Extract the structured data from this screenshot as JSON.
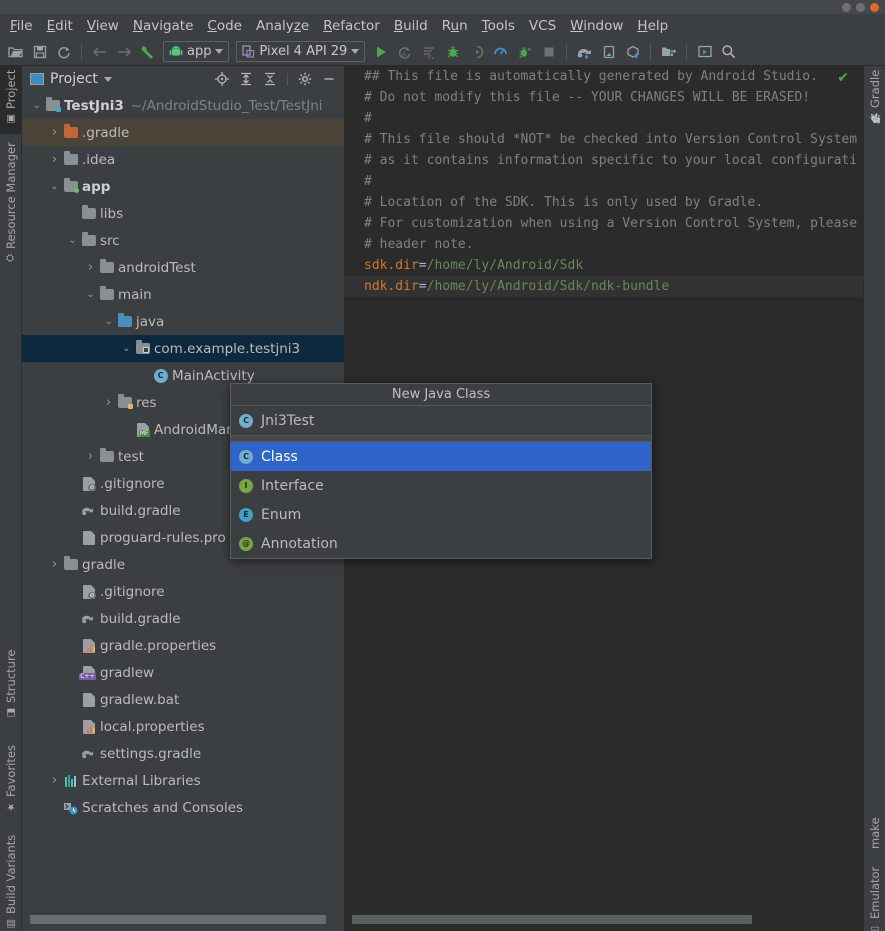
{
  "window": {
    "controls": [
      "minimize",
      "maximize",
      "close"
    ]
  },
  "menubar": {
    "items": [
      {
        "label": "File",
        "mnemonic": "F"
      },
      {
        "label": "Edit",
        "mnemonic": "E"
      },
      {
        "label": "View",
        "mnemonic": "V"
      },
      {
        "label": "Navigate",
        "mnemonic": "N"
      },
      {
        "label": "Code",
        "mnemonic": "C"
      },
      {
        "label": "Analyze",
        "mnemonic": "z"
      },
      {
        "label": "Refactor",
        "mnemonic": "R"
      },
      {
        "label": "Build",
        "mnemonic": "B"
      },
      {
        "label": "Run",
        "mnemonic": "u"
      },
      {
        "label": "Tools",
        "mnemonic": "T"
      },
      {
        "label": "VCS",
        "mnemonic": ""
      },
      {
        "label": "Window",
        "mnemonic": "W"
      },
      {
        "label": "Help",
        "mnemonic": "H"
      }
    ]
  },
  "toolbar": {
    "icons_left": [
      "open-folder-icon",
      "save-icon",
      "sync-icon"
    ],
    "nav_icons": [
      "back-arrow-icon",
      "forward-arrow-icon",
      "hammer-icon"
    ],
    "run_config": {
      "label": "app",
      "icon": "android-robot-icon"
    },
    "device": {
      "label": "Pixel 4 API 29",
      "icon": "device-icon"
    },
    "run_icons": [
      "run-icon",
      "apply-changes-icon",
      "apply-code-changes-icon",
      "debug-icon",
      "attach-debugger-icon",
      "profiler-icon",
      "run-with-coverage-icon",
      "stop-icon"
    ],
    "gradle_icons": [
      "gradle-sync-icon",
      "avd-manager-icon",
      "sdk-manager-icon"
    ],
    "extra_icons": [
      "project-structure-icon",
      "layout-inspector-icon",
      "search-icon"
    ]
  },
  "left_strip": {
    "top_tabs": [
      {
        "label": "Project",
        "icon": "project-icon",
        "active": true
      },
      {
        "label": "Resource Manager",
        "icon": "resource-manager-icon",
        "active": false
      }
    ],
    "bottom_tabs": [
      {
        "label": "Structure",
        "icon": "structure-icon"
      },
      {
        "label": "Favorites",
        "icon": "star-icon"
      },
      {
        "label": "Build Variants",
        "icon": "build-variants-icon"
      }
    ]
  },
  "right_strip": {
    "top_tabs": [
      {
        "label": "Gradle",
        "icon": "gradle-elephant-icon"
      }
    ],
    "bottom_tabs": [
      {
        "label": "make",
        "icon": ""
      },
      {
        "label": "Emulator",
        "icon": "emulator-icon"
      }
    ]
  },
  "project_panel": {
    "title": "Project",
    "header_icons": [
      "locate-icon",
      "expand-all-icon",
      "collapse-all-icon",
      "settings-gear-icon",
      "hide-icon"
    ],
    "tree": [
      {
        "label": "TestJni3",
        "path": "~/AndroidStudio_Test/TestJni",
        "depth": 0,
        "arrow": "expanded",
        "icon": "module-folder-icon",
        "bold": true,
        "state": "normal"
      },
      {
        "label": ".gradle",
        "depth": 1,
        "arrow": "collapsed",
        "icon": "folder-orange-icon",
        "bold": false,
        "state": "hover"
      },
      {
        "label": ".idea",
        "depth": 1,
        "arrow": "collapsed",
        "icon": "folder-icon",
        "bold": false,
        "state": "normal"
      },
      {
        "label": "app",
        "depth": 1,
        "arrow": "expanded",
        "icon": "module-folder-green-icon",
        "bold": true,
        "state": "normal"
      },
      {
        "label": "libs",
        "depth": 2,
        "arrow": "none",
        "icon": "folder-icon",
        "bold": false,
        "state": "normal"
      },
      {
        "label": "src",
        "depth": 2,
        "arrow": "expanded",
        "icon": "folder-icon",
        "bold": false,
        "state": "normal"
      },
      {
        "label": "androidTest",
        "depth": 3,
        "arrow": "collapsed",
        "icon": "folder-icon",
        "bold": false,
        "state": "normal"
      },
      {
        "label": "main",
        "depth": 3,
        "arrow": "expanded",
        "icon": "folder-icon",
        "bold": false,
        "state": "normal"
      },
      {
        "label": "java",
        "depth": 4,
        "arrow": "expanded",
        "icon": "folder-blue-icon",
        "bold": false,
        "state": "normal"
      },
      {
        "label": "com.example.testjni3",
        "depth": 5,
        "arrow": "expanded",
        "icon": "package-folder-icon",
        "bold": false,
        "state": "selected"
      },
      {
        "label": "MainActivity",
        "depth": 6,
        "arrow": "none",
        "icon": "java-class-icon",
        "bold": false,
        "state": "normal"
      },
      {
        "label": "res",
        "depth": 4,
        "arrow": "collapsed",
        "icon": "res-folder-icon",
        "bold": false,
        "state": "normal"
      },
      {
        "label": "AndroidManifest.xml",
        "depth": 5,
        "arrow": "none",
        "icon": "manifest-file-icon",
        "bold": false,
        "state": "normal"
      },
      {
        "label": "test",
        "depth": 3,
        "arrow": "collapsed",
        "icon": "folder-icon",
        "bold": false,
        "state": "normal"
      },
      {
        "label": ".gitignore",
        "depth": 2,
        "arrow": "none",
        "icon": "gitignore-file-icon",
        "bold": false,
        "state": "normal"
      },
      {
        "label": "build.gradle",
        "depth": 2,
        "arrow": "none",
        "icon": "gradle-file-icon",
        "bold": false,
        "state": "normal"
      },
      {
        "label": "proguard-rules.pro",
        "depth": 2,
        "arrow": "none",
        "icon": "text-file-icon",
        "bold": false,
        "state": "normal"
      },
      {
        "label": "gradle",
        "depth": 1,
        "arrow": "collapsed",
        "icon": "folder-icon",
        "bold": false,
        "state": "normal"
      },
      {
        "label": ".gitignore",
        "depth": 2,
        "arrow": "none",
        "icon": "gitignore-file-icon",
        "bold": false,
        "state": "normal"
      },
      {
        "label": "build.gradle",
        "depth": 2,
        "arrow": "none",
        "icon": "gradle-file-icon",
        "bold": false,
        "state": "normal"
      },
      {
        "label": "gradle.properties",
        "depth": 2,
        "arrow": "none",
        "icon": "properties-file-icon",
        "bold": false,
        "state": "normal"
      },
      {
        "label": "gradlew",
        "depth": 2,
        "arrow": "none",
        "icon": "cpp-file-icon",
        "bold": false,
        "state": "normal"
      },
      {
        "label": "gradlew.bat",
        "depth": 2,
        "arrow": "none",
        "icon": "text-file-icon",
        "bold": false,
        "state": "normal"
      },
      {
        "label": "local.properties",
        "depth": 2,
        "arrow": "none",
        "icon": "properties-file-icon",
        "bold": false,
        "state": "normal"
      },
      {
        "label": "settings.gradle",
        "depth": 2,
        "arrow": "none",
        "icon": "gradle-file-icon",
        "bold": false,
        "state": "normal"
      },
      {
        "label": "External Libraries",
        "depth": 1,
        "arrow": "collapsed",
        "icon": "libraries-icon",
        "bold": false,
        "state": "normal"
      },
      {
        "label": "Scratches and Consoles",
        "depth": 1,
        "arrow": "none",
        "icon": "scratches-icon",
        "bold": false,
        "state": "normal"
      }
    ]
  },
  "editor": {
    "status_icon": "inspection-ok-check",
    "lines": [
      {
        "segments": [
          {
            "t": "## This file is automatically generated by Android Studio.",
            "c": "comment"
          }
        ]
      },
      {
        "segments": [
          {
            "t": "# Do not modify this file -- YOUR CHANGES WILL BE ERASED!",
            "c": "comment"
          }
        ]
      },
      {
        "segments": [
          {
            "t": "#",
            "c": "comment"
          }
        ]
      },
      {
        "segments": [
          {
            "t": "# This file should *NOT* be checked into Version Control System",
            "c": "comment"
          }
        ]
      },
      {
        "segments": [
          {
            "t": "# as it contains information specific to your local configurati",
            "c": "comment"
          }
        ]
      },
      {
        "segments": [
          {
            "t": "#",
            "c": "comment"
          }
        ]
      },
      {
        "segments": [
          {
            "t": "# Location of the SDK. This is only used by Gradle.",
            "c": "comment"
          }
        ]
      },
      {
        "segments": [
          {
            "t": "# For customization when using a Version Control System, please",
            "c": "comment"
          }
        ]
      },
      {
        "segments": [
          {
            "t": "# header note.",
            "c": "comment"
          }
        ]
      },
      {
        "segments": [
          {
            "t": "sdk.dir",
            "c": "key"
          },
          {
            "t": "=",
            "c": "op"
          },
          {
            "t": "/home/ly/Android/Sdk",
            "c": "value"
          }
        ]
      },
      {
        "segments": [
          {
            "t": "ndk.dir",
            "c": "key"
          },
          {
            "t": "=",
            "c": "op"
          },
          {
            "t": "/home/ly/Android/Sdk/ndk-bundle",
            "c": "value"
          }
        ],
        "highlight": true
      }
    ]
  },
  "popup": {
    "title": "New Java Class",
    "items": [
      {
        "label": "Jni3Test",
        "icon": "class-icon",
        "kind": "c",
        "active": false
      },
      {
        "separator": true
      },
      {
        "label": "Class",
        "icon": "class-icon",
        "kind": "c",
        "active": true
      },
      {
        "label": "Interface",
        "icon": "interface-icon",
        "kind": "i",
        "active": false
      },
      {
        "label": "Enum",
        "icon": "enum-icon",
        "kind": "e",
        "active": false
      },
      {
        "label": "Annotation",
        "icon": "annotation-icon",
        "kind": "a",
        "active": false
      }
    ]
  },
  "colors": {
    "background": "#3c3f41",
    "editor_background": "#2b2b2b",
    "selection_blue": "#0d293e",
    "popup_highlight": "#2f65ca",
    "hover_brown": "#4a4338",
    "accent_green": "#4aa84a",
    "keyword_orange": "#cc7832",
    "value_green": "#6a8759"
  }
}
